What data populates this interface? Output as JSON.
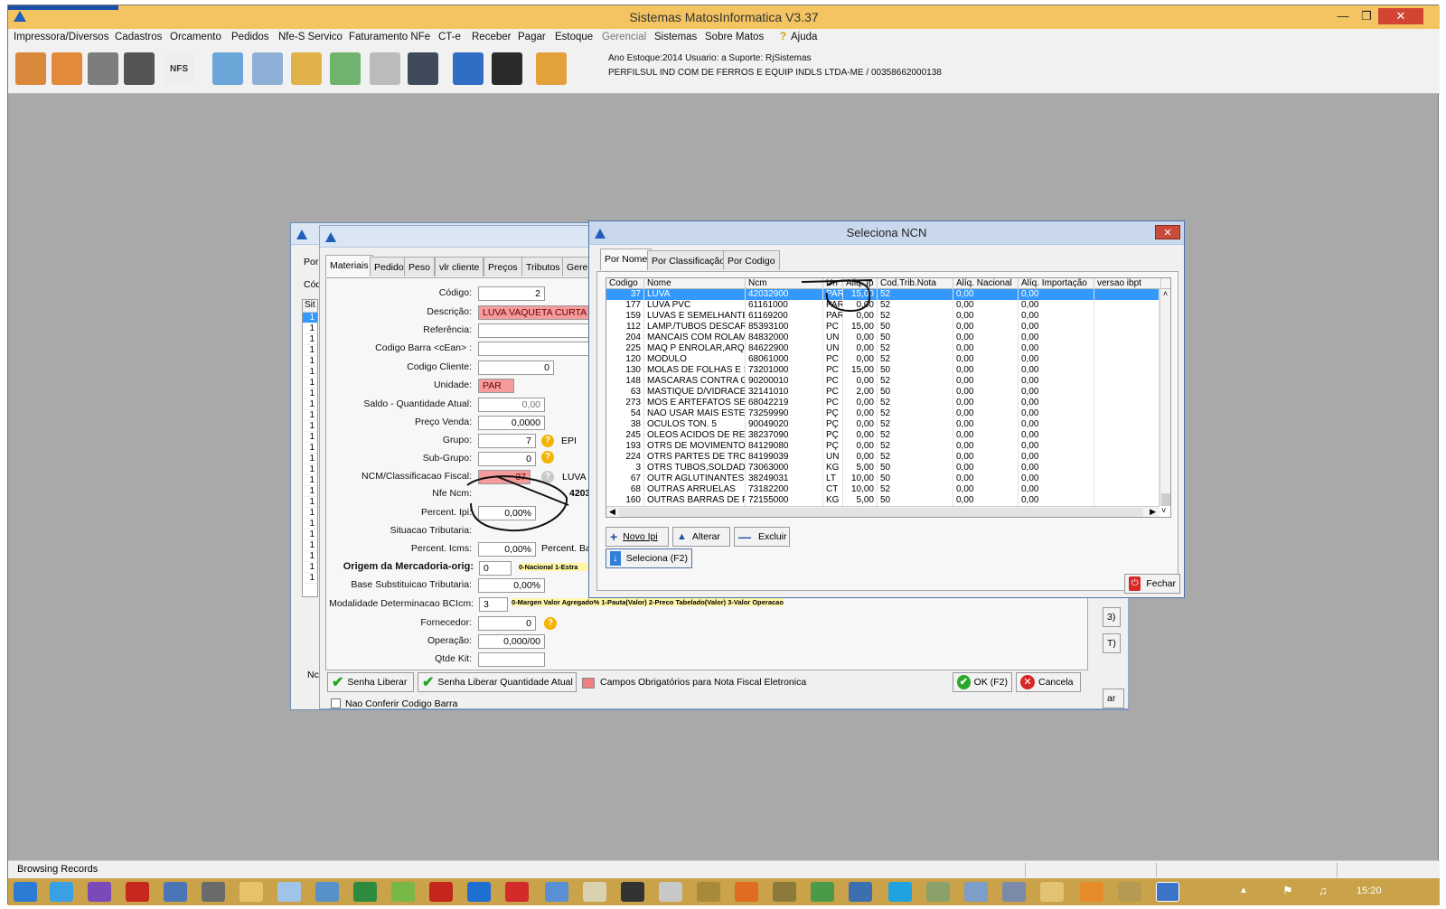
{
  "app": {
    "title": "Sistemas MatosInformatica V3.37",
    "menu": [
      "Impressora/Diversos",
      "Cadastros",
      "Orcamento",
      "Pedidos",
      "Nfe-S Servico",
      "Faturamento NFe",
      "CT-e",
      "Receber",
      "Pagar",
      "Estoque",
      "Gerencial",
      "Sistemas",
      "Sobre Matos",
      "Ajuda"
    ],
    "toolbar_nfs": "NFS",
    "info_line1": "Ano Estoque:2014 Usuario: a Suporte: RjSistemas",
    "info_line2": "PERFILSUL IND COM DE FERROS E EQUIP INDLS  LTDA-ME / 00358662000138",
    "status": "Browsing Records",
    "clock": "15:20"
  },
  "back_dialog": {
    "left_tabs": [
      "Por",
      "Cód",
      "Sit"
    ],
    "left_rows": [
      "1",
      "1",
      "1",
      "1",
      "1",
      "1",
      "1",
      "1",
      "1",
      "1",
      "1",
      "1",
      "1",
      "1",
      "1",
      "1",
      "1",
      "1",
      "1",
      "1",
      "1",
      "1",
      "1",
      "1",
      "1"
    ],
    "left_bottom": "Nc",
    "tabs": [
      "Materiais",
      "Pedido",
      "Peso",
      "vlr cliente",
      "Preços",
      "Tributos",
      "Geren"
    ],
    "fields": {
      "codigo_label": "Código:",
      "codigo": "2",
      "descricao_label": "Descrição:",
      "descricao": "LUVA VAQUETA CURTA",
      "referencia_label": "Referência:",
      "codbarra_label": "Codigo Barra <cEan> :",
      "codcliente_label": "Codigo Cliente:",
      "codcliente": "0",
      "unidade_label": "Unidade:",
      "unidade": "PAR",
      "saldo_label": "Saldo - Quantidade Atual:",
      "saldo": "0,00",
      "preco_label": "Preço Venda:",
      "preco": "0,0000",
      "grupo_label": "Grupo:",
      "grupo": "7",
      "grupo_desc": "EPI",
      "subgrupo_label": "Sub-Grupo:",
      "subgrupo": "0",
      "ncm_label": "NCM/Classificacao Fiscal:",
      "ncm": "37",
      "ncm_desc": "LUVA",
      "nfencm_label": "Nfe Ncm:",
      "nfencm": "4203",
      "ipi_label": "Percent. Ipi:",
      "ipi": "0,00%",
      "sittrib_label": "Situacao Tributaria:",
      "icms_label": "Percent. Icms:",
      "icms": "0,00%",
      "percbase_label": "Percent. Ba",
      "origem_label": "Origem da Mercadoria-orig:",
      "origem": "0",
      "origem_hint": "0-Nacional 1-Estra",
      "basesub_label": "Base Substituicao Tributaria:",
      "basesub": "0,00%",
      "modal_label": "Modalidade Determinacao BCIcm:",
      "modal": "3",
      "modal_hint": "0-Margen Valor Agregado% 1-Pauta(Valor) 2-Preco Tabelado(Valor) 3-Valor Operacao",
      "fornecedor_label": "Fornecedor:",
      "fornecedor": "0",
      "operacao_label": "Operação:",
      "operacao": "0,000/00",
      "qtdekit_label": "Qtde Kit:"
    },
    "buttons": {
      "senha": "Senha Liberar",
      "senha_qtd": "Senha Liberar Quantidade Atual",
      "legenda": "Campos Obrigatórios para Nota Fiscal Eletronica",
      "ok": "OK (F2)",
      "cancela": "Cancela",
      "nao_conferir": "Nao Conferir Codigo Barra"
    },
    "side_btns": [
      "3)",
      "T)",
      "ar"
    ]
  },
  "ncn_dialog": {
    "title": "Seleciona NCN",
    "tabs": [
      "Por Nome",
      "Por Classificação",
      "Por Codigo"
    ],
    "columns": [
      "Codigo",
      "Nome",
      "Ncm",
      "Un",
      "Aliq. Ip",
      "Cod.Trib.Nota",
      "Alíq. Nacional",
      "Alíq. Importação",
      "versao ibpt"
    ],
    "rows": [
      [
        "37",
        "LUVA",
        "42032900",
        "PAR",
        "15,00",
        "52",
        "0,00",
        "0,00"
      ],
      [
        "177",
        "LUVA PVC",
        "61161000",
        "PAR",
        "0,00",
        "52",
        "0,00",
        "0,00"
      ],
      [
        "159",
        "LUVAS E SEMELHANTE",
        "61169200",
        "PAR",
        "0,00",
        "52",
        "0,00",
        "0,00"
      ],
      [
        "112",
        "LAMP./TUBOS DESCAR",
        "85393100",
        "PC",
        "15,00",
        "50",
        "0,00",
        "0,00"
      ],
      [
        "204",
        "MANCAIS COM ROLAM",
        "84832000",
        "UN",
        "0,00",
        "50",
        "0,00",
        "0,00"
      ],
      [
        "225",
        "MAQ P ENROLAR,ARQ",
        "84622900",
        "UN",
        "0,00",
        "52",
        "0,00",
        "0,00"
      ],
      [
        "120",
        "MODULO",
        "68061000",
        "PC",
        "0,00",
        "52",
        "0,00",
        "0,00"
      ],
      [
        "130",
        "MOLAS DE FOLHAS E S",
        "73201000",
        "PC",
        "15,00",
        "50",
        "0,00",
        "0,00"
      ],
      [
        "148",
        "MÁSCARAS CONTRA G",
        "90200010",
        "PC",
        "0,00",
        "52",
        "0,00",
        "0,00"
      ],
      [
        "63",
        "MÁSTIQUE D/VIDRACE",
        "32141010",
        "PC",
        "2,00",
        "50",
        "0,00",
        "0,00"
      ],
      [
        "273",
        "MÓS E ARTEFATOS SE",
        "68042219",
        "PC",
        "0,00",
        "52",
        "0,00",
        "0,00"
      ],
      [
        "54",
        "NÃO USAR MAIS ESTE",
        "73259990",
        "PÇ",
        "0,00",
        "52",
        "0,00",
        "0,00"
      ],
      [
        "38",
        "OCULOS TON. 5",
        "90049020",
        "PÇ",
        "0,00",
        "52",
        "0,00",
        "0,00"
      ],
      [
        "245",
        "OLEOS ACIDOS DE REI",
        "38237090",
        "PÇ",
        "0,00",
        "52",
        "0,00",
        "0,00"
      ],
      [
        "193",
        "OTRS DE MOVIMENTO",
        "84129080",
        "PÇ",
        "0,00",
        "52",
        "0,00",
        "0,00"
      ],
      [
        "224",
        "OTRS PARTES DE TRO",
        "84199039",
        "UN",
        "0,00",
        "52",
        "0,00",
        "0,00"
      ],
      [
        "3",
        "OTRS TUBOS,SOLDAD",
        "73063000",
        "KG",
        "5,00",
        "50",
        "0,00",
        "0,00"
      ],
      [
        "67",
        "OUTR AGLUTINANTES",
        "38249031",
        "LT",
        "10,00",
        "50",
        "0,00",
        "0,00"
      ],
      [
        "68",
        "OUTRAS ARRUELAS",
        "73182200",
        "CT",
        "10,00",
        "52",
        "0,00",
        "0,00"
      ],
      [
        "160",
        "OUTRAS BARRAS DE F",
        "72155000",
        "KG",
        "5,00",
        "50",
        "0,00",
        "0,00"
      ]
    ],
    "buttons": {
      "novo": "Novo Ipi",
      "alterar": "Alterar",
      "excluir": "Excluir",
      "seleciona": "Seleciona (F2)",
      "fechar": "Fechar"
    }
  }
}
